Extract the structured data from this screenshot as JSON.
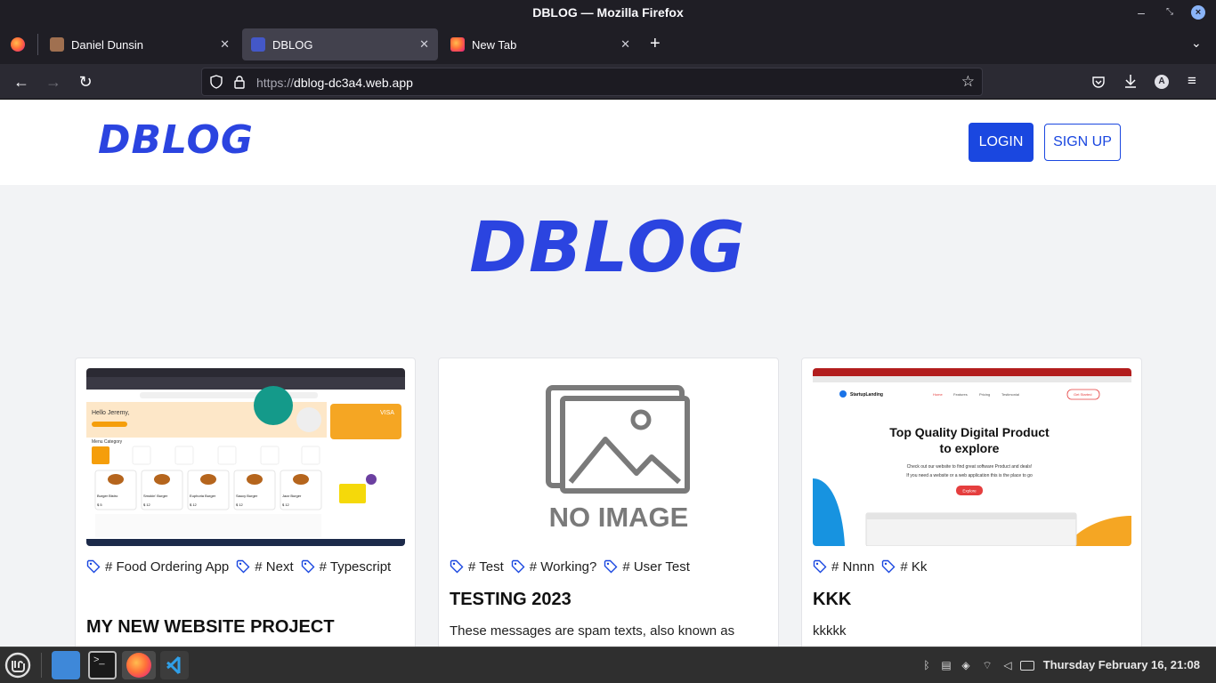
{
  "window": {
    "title": "DBLOG — Mozilla Firefox"
  },
  "tabs": [
    {
      "label": "Daniel Dunsin",
      "active": false
    },
    {
      "label": "DBLOG",
      "active": true
    },
    {
      "label": "New Tab",
      "active": false
    }
  ],
  "urlbar": {
    "scheme": "https://",
    "host": "dblog-dc3a4.web.app"
  },
  "site": {
    "logo": "DBLOG",
    "login_label": "LOGIN",
    "signup_label": "SIGN UP",
    "hero_title": "DBLOG"
  },
  "posts": [
    {
      "tags": [
        "# Food Ordering App",
        "# Next",
        "# Typescript"
      ],
      "title": "MY NEW WEBSITE PROJECT",
      "description": "",
      "image": "screenshot",
      "thumb": {
        "greeting": "Hello Jeremy,",
        "menu_label": "Menu Category",
        "card_brand": "VISA",
        "items": [
          "Burger Bistro",
          "Smokin' Burger",
          "Euphoria Burger",
          "Saucy Burger",
          "Jazz Burger"
        ],
        "prices": [
          "$ 5",
          "$ 12",
          "$ 12",
          "$ 12",
          "$ 12"
        ]
      }
    },
    {
      "tags": [
        "# Test",
        "# Working?",
        "# User Test"
      ],
      "title": "TESTING 2023",
      "description": "These messages are spam texts, also known as",
      "image": "no-image",
      "placeholder_text": "NO IMAGE"
    },
    {
      "tags": [
        "# Nnnn",
        "# Kk"
      ],
      "title": "KKK",
      "description": "kkkkk",
      "image": "screenshot",
      "thumb": {
        "brand": "StartupLanding",
        "nav": [
          "Home",
          "Features",
          "Pricing",
          "Testimonial"
        ],
        "cta": "Get Started",
        "headline_1": "Top Quality Digital Product",
        "headline_2": "to explore",
        "sub_1": "Check out our website to find great software Product and deals!",
        "sub_2": "If you need a website or a web application this is the place to go",
        "button": "Explore"
      }
    }
  ],
  "taskbar": {
    "clock": "Thursday February 16, 21:08"
  },
  "colors": {
    "brand": "#2b44e0",
    "button": "#1a47e0",
    "page_bg": "#f2f3f5"
  }
}
